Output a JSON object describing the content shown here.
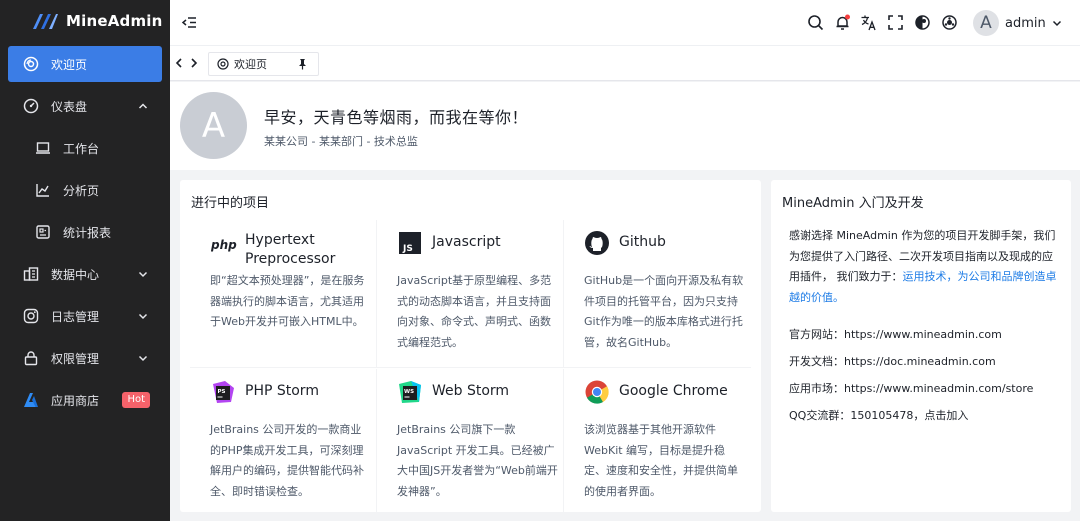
{
  "app": {
    "name": "MineAdmin"
  },
  "sidebar": {
    "items": [
      {
        "label": "欢迎页",
        "icon": "welcome-icon",
        "active": true
      },
      {
        "label": "仪表盘",
        "icon": "dashboard-icon",
        "expanded": true
      },
      {
        "label": "工作台",
        "icon": "laptop-icon",
        "sub": true
      },
      {
        "label": "分析页",
        "icon": "analysis-chart-icon",
        "sub": true
      },
      {
        "label": "统计报表",
        "icon": "report-icon",
        "sub": true
      },
      {
        "label": "数据中心",
        "icon": "data-center-icon"
      },
      {
        "label": "日志管理",
        "icon": "instagram-icon"
      },
      {
        "label": "权限管理",
        "icon": "lock-icon"
      },
      {
        "label": "应用商店",
        "icon": "app-store-icon",
        "badge": "Hot"
      }
    ],
    "colors": {
      "background": "#232324",
      "active": "#3b7de6",
      "badge": "#f5626a"
    }
  },
  "header": {
    "user_initial": "A",
    "user_name": "admin",
    "icons": [
      "menu-fold-icon",
      "search-icon",
      "notification-bell-icon",
      "translate-icon",
      "fullscreen-icon",
      "theme-icon",
      "settings-icon"
    ]
  },
  "tabs": {
    "items": [
      {
        "label": "欢迎页"
      }
    ]
  },
  "welcome": {
    "avatar_initial": "A",
    "greeting": "早安，天青色等烟雨，而我在等你！",
    "subtitle": "某某公司 - 某某部门 - 技术总监"
  },
  "projects": {
    "title": "进行中的项目",
    "items": [
      {
        "name": "Hypertext Preprocessor",
        "icon": "php-icon",
        "desc": "即“超文本预处理器”，是在服务器端执行的脚本语言，尤其适用于Web开发并可嵌入HTML中。"
      },
      {
        "name": "Javascript",
        "icon": "javascript-icon",
        "desc": "JavaScript基于原型编程、多范式的动态脚本语言，并且支持面向对象、命令式、声明式、函数式编程范式。"
      },
      {
        "name": "Github",
        "icon": "github-icon",
        "desc": "GitHub是一个面向开源及私有软件项目的托管平台，因为只支持Git作为唯一的版本库格式进行托管，故名GitHub。"
      },
      {
        "name": "PHP Storm",
        "icon": "phpstorm-icon",
        "desc": "JetBrains 公司开发的一款商业的PHP集成开发工具，可深刻理解用户的编码，提供智能代码补全、即时错误检查。"
      },
      {
        "name": "Web Storm",
        "icon": "webstorm-icon",
        "desc": "JetBrains 公司旗下一款JavaScript 开发工具。已经被广大中国JS开发者誉为“Web前端开发神器”。"
      },
      {
        "name": "Google Chrome",
        "icon": "chrome-icon",
        "desc": "该浏览器基于其他开源软件WebKit 编写，目标是提升稳定、速度和安全性，并提供简单的使用者界面。"
      }
    ]
  },
  "intro": {
    "title": "MineAdmin 入门及开发",
    "text": "感谢选择 MineAdmin 作为您的项目开发脚手架，我们为您提供了入门路径、二次开发项目指南以及现成的应用插件， 我们致力于：",
    "link": "运用技术，为公司和品牌创造卓越的价值。",
    "lines": [
      {
        "label": "官方网站：",
        "value": "https://www.mineadmin.com"
      },
      {
        "label": "开发文档：",
        "value": "https://doc.mineadmin.com"
      },
      {
        "label": "应用市场：",
        "value": "https://www.mineadmin.com/store"
      },
      {
        "label": "QQ交流群：",
        "value": "150105478，点击加入"
      }
    ]
  }
}
